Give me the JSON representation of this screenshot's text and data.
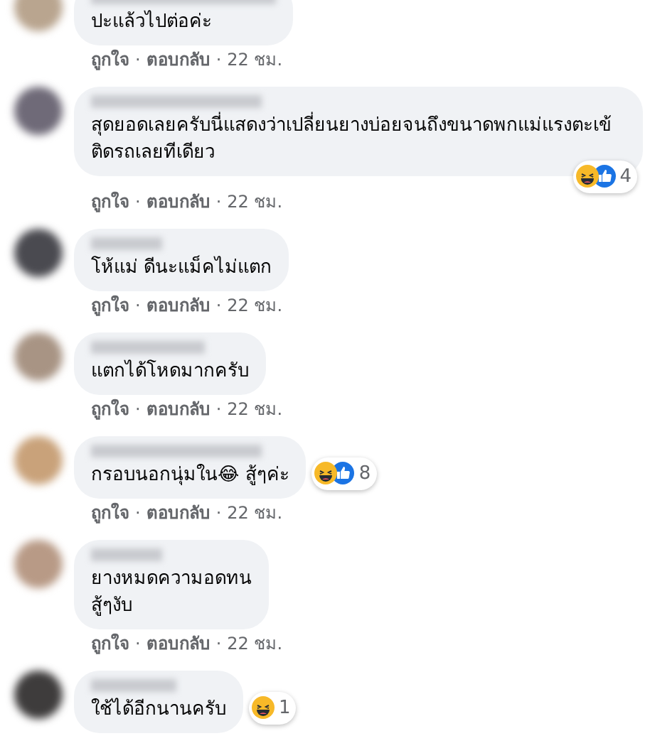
{
  "comments": [
    {
      "text": "ปะแล้วไปต่อค่ะ",
      "actions": {
        "like": "ถูกใจ",
        "reply": "ตอบกลับ",
        "time": "22 ชม.",
        "separator": "·"
      }
    },
    {
      "text": "สุดยอดเลยครับนี่แสดงว่าเปลี่ยนยางบ่อยจนถึงขนาดพกแม่แรงตะเข้ติดรถเลยทีเดียว",
      "reactions": {
        "overlaps_bubble": true,
        "icons": [
          {
            "kind": "haha"
          },
          {
            "kind": "like"
          }
        ],
        "count": "4"
      },
      "actions": {
        "like": "ถูกใจ",
        "reply": "ตอบกลับ",
        "time": "22 ชม.",
        "separator": "·"
      }
    },
    {
      "text": "โห้แม่ ดีนะแม็คไม่แตก",
      "actions": {
        "like": "ถูกใจ",
        "reply": "ตอบกลับ",
        "time": "22 ชม.",
        "separator": "·"
      }
    },
    {
      "text": "แตกได้โหดมากครับ",
      "actions": {
        "like": "ถูกใจ",
        "reply": "ตอบกลับ",
        "time": "22 ชม.",
        "separator": "·"
      }
    },
    {
      "text": "กรอบนอกนุ่มใน😂 สู้ๆค่ะ",
      "reactions": {
        "overlaps_bubble": false,
        "icons": [
          {
            "kind": "haha"
          },
          {
            "kind": "like"
          }
        ],
        "count": "8"
      },
      "actions": {
        "like": "ถูกใจ",
        "reply": "ตอบกลับ",
        "time": "22 ชม.",
        "separator": "·"
      }
    },
    {
      "text": "ยางหมดความอดทน\nสู้ๆงับ",
      "actions": {
        "like": "ถูกใจ",
        "reply": "ตอบกลับ",
        "time": "22 ชม.",
        "separator": "·"
      }
    },
    {
      "text": "ใช้ได้อีกนานครับ",
      "reactions": {
        "overlaps_bubble": false,
        "icons": [
          {
            "kind": "haha"
          }
        ],
        "count": "1"
      }
    }
  ]
}
